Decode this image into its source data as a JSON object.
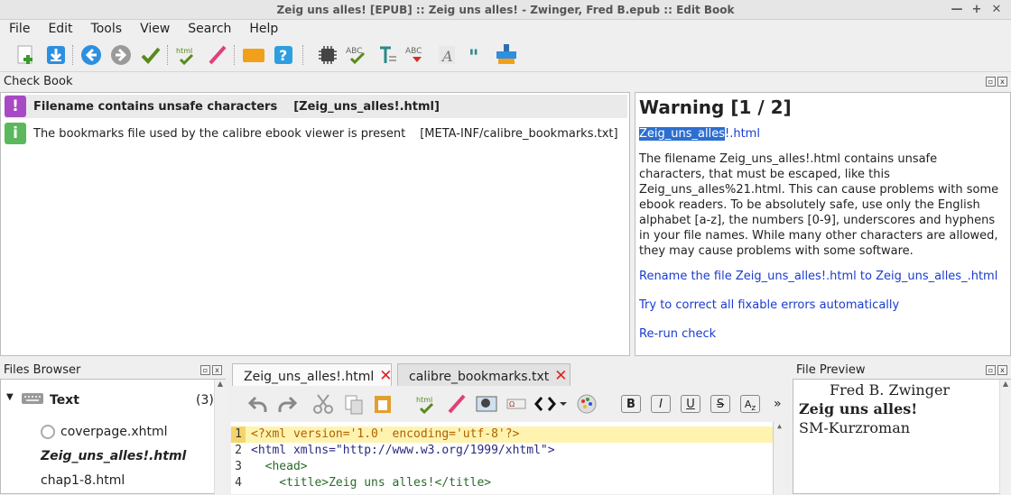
{
  "window": {
    "title": "Zeig uns alles! [EPUB] :: Zeig uns alles! - Zwinger, Fred B.epub :: Edit Book",
    "controls": [
      "—",
      "+",
      "✕"
    ]
  },
  "menubar": {
    "items": [
      "File",
      "Edit",
      "Tools",
      "View",
      "Search",
      "Help"
    ]
  },
  "check_book": {
    "title": "Check Book",
    "items": [
      {
        "severity": "!",
        "message": "Filename contains unsafe characters",
        "location": "[Zeig_uns_alles!.html]",
        "color": "#a84ac4"
      },
      {
        "severity": "i",
        "message": "The bookmarks file used by the calibre ebook viewer is present",
        "location": "[META-INF/calibre_bookmarks.txt]",
        "color": "#5cb85c"
      }
    ]
  },
  "details": {
    "heading": "Warning [1 / 2]",
    "file_selected": "Zeig_uns_alles",
    "file_rest": "!.html",
    "description": "The filename Zeig_uns_alles!.html contains unsafe characters, that must be escaped, like this Zeig_uns_alles%21.html. This can cause problems with some ebook readers. To be absolutely safe, use only the English alphabet [a-z], the numbers [0-9], underscores and hyphens in your file names. While many other characters are allowed, they may cause problems with some software.",
    "action_rename": "Rename the file Zeig_uns_alles!.html to Zeig_uns_alles_.html",
    "action_fix": "Try to correct all fixable errors automatically",
    "action_rerun": "Re-run check"
  },
  "files_browser": {
    "title": "Files Browser",
    "category": "Text",
    "count": "(3)",
    "files": [
      "coverpage.xhtml",
      "Zeig_uns_alles!.html",
      "chap1-8.html"
    ]
  },
  "editor": {
    "tabs": [
      "Zeig_uns_alles!.html",
      "calibre_bookmarks.txt"
    ],
    "more": "»",
    "lines": [
      {
        "n": "1",
        "text": "<?xml version='1.0' encoding='utf-8'?>"
      },
      {
        "n": "2",
        "text": "<html xmlns=\"http://www.w3.org/1999/xhtml\">"
      },
      {
        "n": "3",
        "text": "  <head>"
      },
      {
        "n": "4",
        "text": "    <title>Zeig uns alles!</title>"
      }
    ]
  },
  "file_preview": {
    "title": "File Preview",
    "author": "Fred B. Zwinger",
    "book_title": "Zeig uns alles!",
    "subtitle": "SM-Kurzroman"
  },
  "toolbar_icons": [
    "new-file-icon",
    "import-icon",
    "back-icon",
    "forward-icon",
    "checkmark-icon",
    "html-check-icon",
    "beautify-icon",
    "tag-icon",
    "help-icon",
    "chip-icon",
    "spellcheck-icon",
    "text-icon",
    "spellcheck-underline-icon",
    "font-icon",
    "quote-icon",
    "paint-icon"
  ]
}
